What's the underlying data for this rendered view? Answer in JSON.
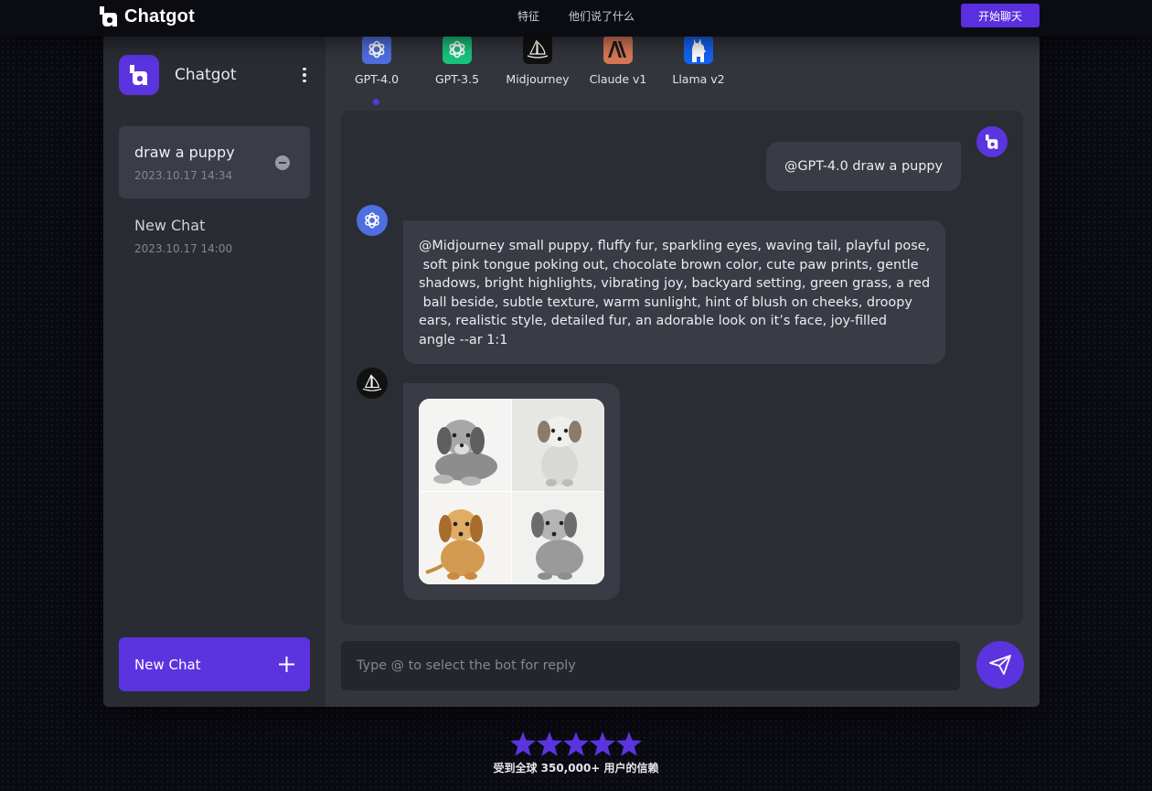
{
  "nav": {
    "brand": "Chatgot",
    "links": [
      "特征",
      "他们说了什么"
    ],
    "cta": "开始聊天"
  },
  "sidebar": {
    "title": "Chatgot",
    "chats": [
      {
        "title": "draw a puppy",
        "date": "2023.10.17 14:34",
        "active": true
      },
      {
        "title": "New Chat",
        "date": "2023.10.17 14:00",
        "active": false
      }
    ],
    "new_chat_label": "New Chat"
  },
  "bots": [
    {
      "label": "GPT-4.0",
      "icon": "openai-icon",
      "color": "#4f6fe0",
      "selected": true
    },
    {
      "label": "GPT-3.5",
      "icon": "openai-icon",
      "color": "#19c37d"
    },
    {
      "label": "Midjourney",
      "icon": "midjourney-sailboat-icon",
      "color": "#111111"
    },
    {
      "label": "Claude v1",
      "icon": "anthropic-icon",
      "color": "#d97757"
    },
    {
      "label": "Llama v2",
      "icon": "llama-icon",
      "color": "#1662f0"
    }
  ],
  "messages": {
    "user": "@GPT-4.0 draw a puppy",
    "gpt_lines": [
      "@Midjourney small puppy, fluffy fur, sparkling eyes, waving tail, playful pose,",
      " soft pink tongue poking out, chocolate brown color, cute paw prints, gentle",
      "shadows, bright highlights, vibrating joy, backyard setting, green grass, a red",
      " ball beside, subtle texture, warm sunlight, hint of blush on cheeks, droopy",
      "ears, realistic style, detailed fur, an adorable look on it’s face, joy-filled",
      "angle --ar 1:1"
    ],
    "midjourney_images": [
      "puppy-sketch-gray-lying",
      "puppy-sketch-sitting",
      "puppy-golden-sitting",
      "puppy-gray-sitting"
    ]
  },
  "input": {
    "placeholder": "Type @ to select the bot for reply"
  },
  "rating": {
    "stars": 5,
    "text": "受到全球 350,000+ 用户的信赖"
  },
  "colors": {
    "accent": "#5b34e0",
    "background": "#0a0a12"
  }
}
